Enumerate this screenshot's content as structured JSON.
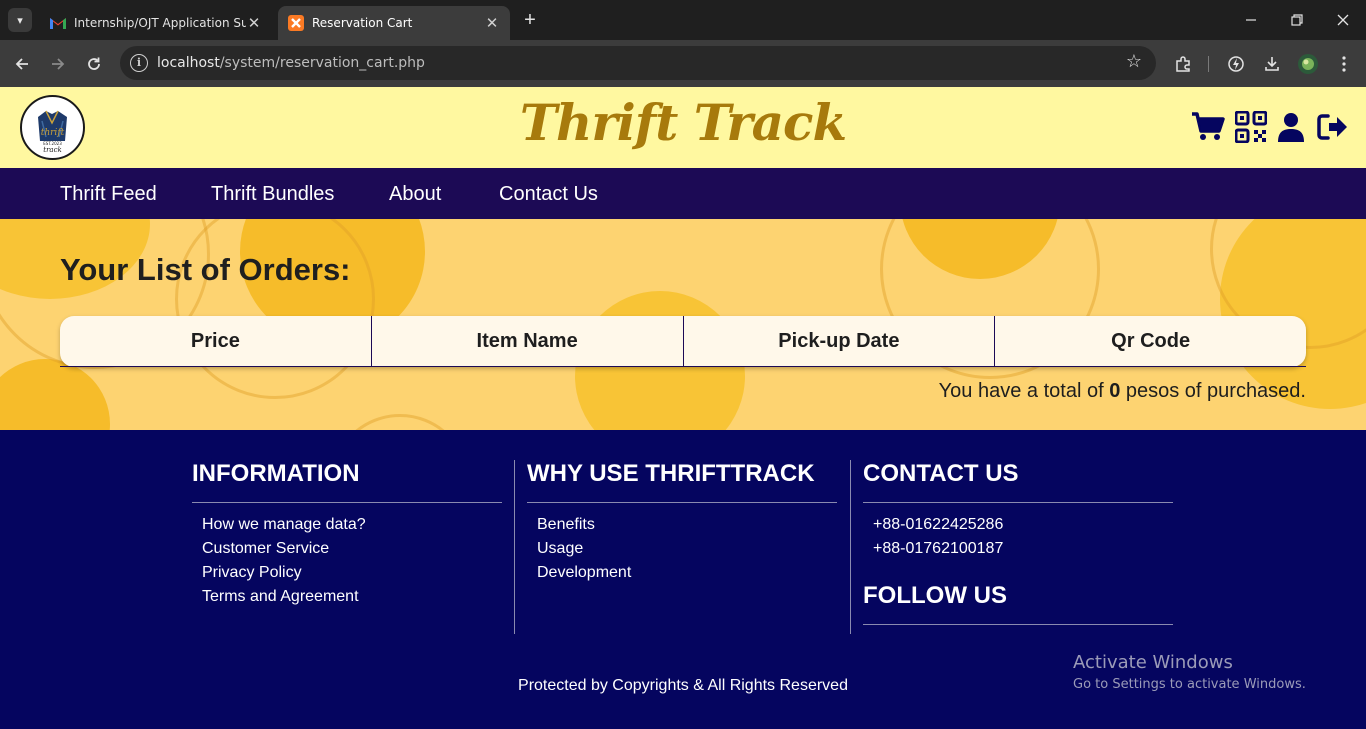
{
  "browser": {
    "tabs": [
      {
        "title": "Internship/OJT Application Subm",
        "favicon": "gmail-icon",
        "active": false
      },
      {
        "title": "Reservation Cart",
        "favicon": "xampp-icon",
        "active": true
      }
    ],
    "url_host": "localhost",
    "url_path": "/system/reservation_cart.php",
    "close_glyph": "✕",
    "new_tab_glyph": "+"
  },
  "header": {
    "brand": "Thrift Track",
    "logo": {
      "top_text": "thrift",
      "year": "EST.2023",
      "bottom_text": "track"
    },
    "icons": [
      "cart-icon",
      "qr-code-icon",
      "user-icon",
      "logout-icon"
    ],
    "accent": "#1c0a55",
    "background": "#fff8a0"
  },
  "nav": {
    "items": [
      "Thrift Feed",
      "Thrift Bundles",
      "About",
      "Contact Us"
    ]
  },
  "main": {
    "title": "Your List of Orders:",
    "columns": [
      "Price",
      "Item Name",
      "Pick-up Date",
      "Qr Code"
    ],
    "rows": [],
    "total_prefix": "You have a total of ",
    "total_amount": "0",
    "total_suffix": " pesos of purchased."
  },
  "footer": {
    "information": {
      "title": "INFORMATION",
      "links": [
        "How we manage data?",
        "Customer Service",
        "Privacy Policy",
        "Terms and Agreement"
      ]
    },
    "why": {
      "title": "WHY USE THRIFTTRACK",
      "links": [
        "Benefits",
        "Usage",
        "Development"
      ]
    },
    "contact": {
      "title": "CONTACT US",
      "phones": [
        "+88-01622425286",
        "+88-01762100187"
      ]
    },
    "follow_title": "FOLLOW US",
    "copyright": "Protected by Copyrights & All Rights Reserved",
    "background": "#05055f"
  },
  "watermark": {
    "line1": "Activate Windows",
    "line2": "Go to Settings to activate Windows."
  }
}
